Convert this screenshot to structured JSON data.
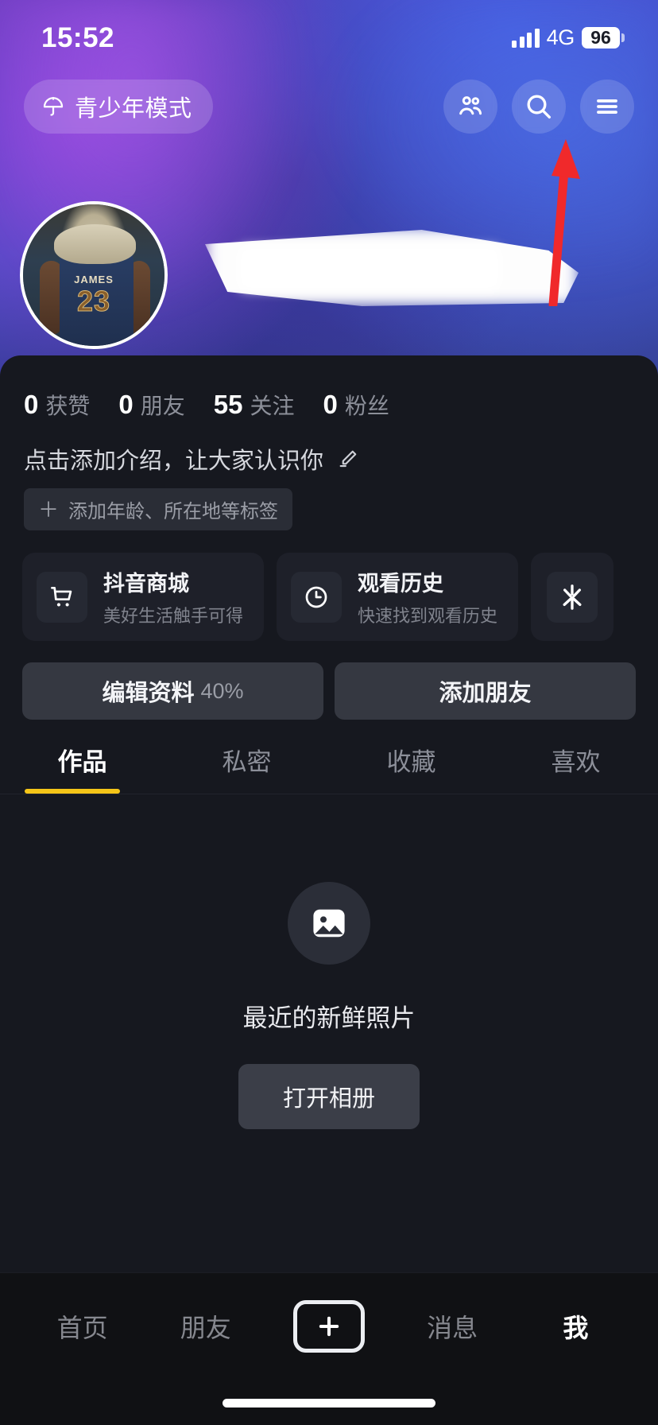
{
  "status_bar": {
    "time": "15:52",
    "network": "4G",
    "battery": "96",
    "signal_icon": "signal-bars-icon",
    "battery_icon": "battery-icon"
  },
  "header": {
    "teen_mode": {
      "label": "青少年模式",
      "icon": "umbrella-icon"
    },
    "icons": [
      {
        "name": "add-friends-icon",
        "label": "添加朋友"
      },
      {
        "name": "search-icon",
        "label": "搜索"
      },
      {
        "name": "hamburger-menu-icon",
        "label": "菜单"
      }
    ],
    "annotation": {
      "name": "red-arrow-annotation",
      "color": "#f0292b",
      "points_to": "hamburger-menu-icon"
    }
  },
  "profile": {
    "avatar": {
      "name": "avatar",
      "jersey_name": "JAMES",
      "jersey_number": "23"
    },
    "display_name_redacted": true,
    "stats": [
      {
        "num": "0",
        "label": "获赞"
      },
      {
        "num": "0",
        "label": "朋友"
      },
      {
        "num": "55",
        "label": "关注"
      },
      {
        "num": "0",
        "label": "粉丝"
      }
    ],
    "bio_placeholder": "点击添加介绍，让大家认识你",
    "bio_edit_icon": "pencil-icon",
    "tag_chip": {
      "plus": "＋",
      "label": "添加年龄、所在地等标签"
    }
  },
  "shortcut_cards": [
    {
      "title": "抖音商城",
      "subtitle": "美好生活触手可得",
      "icon": "shopping-cart-icon"
    },
    {
      "title": "观看历史",
      "subtitle": "快速找到观看历史",
      "icon": "clock-icon"
    },
    {
      "title": "",
      "subtitle": "",
      "icon": "spark-icon"
    }
  ],
  "action_buttons": [
    {
      "label": "编辑资料",
      "suffix": "40%",
      "name": "edit-profile-button"
    },
    {
      "label": "添加朋友",
      "suffix": "",
      "name": "add-friend-button"
    }
  ],
  "content_tabs": [
    {
      "label": "作品",
      "active": true
    },
    {
      "label": "私密",
      "active": false
    },
    {
      "label": "收藏",
      "active": false
    },
    {
      "label": "喜欢",
      "active": false
    }
  ],
  "empty_state": {
    "icon": "image-placeholder-icon",
    "title": "最近的新鲜照片",
    "button_label": "打开相册"
  },
  "bottom_nav": [
    {
      "label": "首页",
      "active": false,
      "name": "nav-home"
    },
    {
      "label": "朋友",
      "active": false,
      "name": "nav-friends"
    },
    {
      "label": "+",
      "active": false,
      "name": "nav-create"
    },
    {
      "label": "消息",
      "active": false,
      "name": "nav-messages"
    },
    {
      "label": "我",
      "active": true,
      "name": "nav-me"
    }
  ],
  "colors": {
    "accent_tab": "#f5c518",
    "panel_bg": "#16181f",
    "card_bg": "#1e2029",
    "annotation_red": "#f0292b"
  }
}
